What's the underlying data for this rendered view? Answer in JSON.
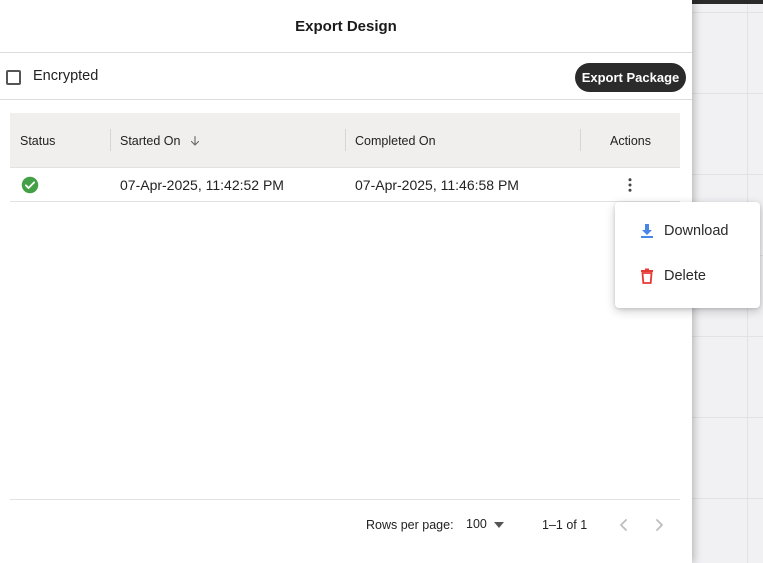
{
  "dialog": {
    "title": "Export Design"
  },
  "toolbar": {
    "encrypted_label": "Encrypted",
    "encrypted_checked": false,
    "export_button": "Export Package"
  },
  "table": {
    "columns": {
      "status": "Status",
      "started_on": "Started On",
      "completed_on": "Completed On",
      "actions": "Actions"
    },
    "sort": {
      "column": "started_on",
      "direction": "descending"
    },
    "rows": [
      {
        "status": "success",
        "started_on": "07-Apr-2025, 11:42:52 PM",
        "completed_on": "07-Apr-2025, 11:46:58 PM"
      }
    ]
  },
  "row_menu": {
    "items": [
      {
        "label": "Download",
        "icon": "download-icon",
        "color": "#4a86e8"
      },
      {
        "label": "Delete",
        "icon": "trash-icon",
        "color": "#e53935"
      }
    ]
  },
  "pagination": {
    "rows_per_page_label": "Rows per page:",
    "rows_per_page": "100",
    "range": "1–1 of 1"
  },
  "colors": {
    "success": "#43a047",
    "header_bg": "#f1eeee",
    "primary_button": "#2b2b2b"
  }
}
